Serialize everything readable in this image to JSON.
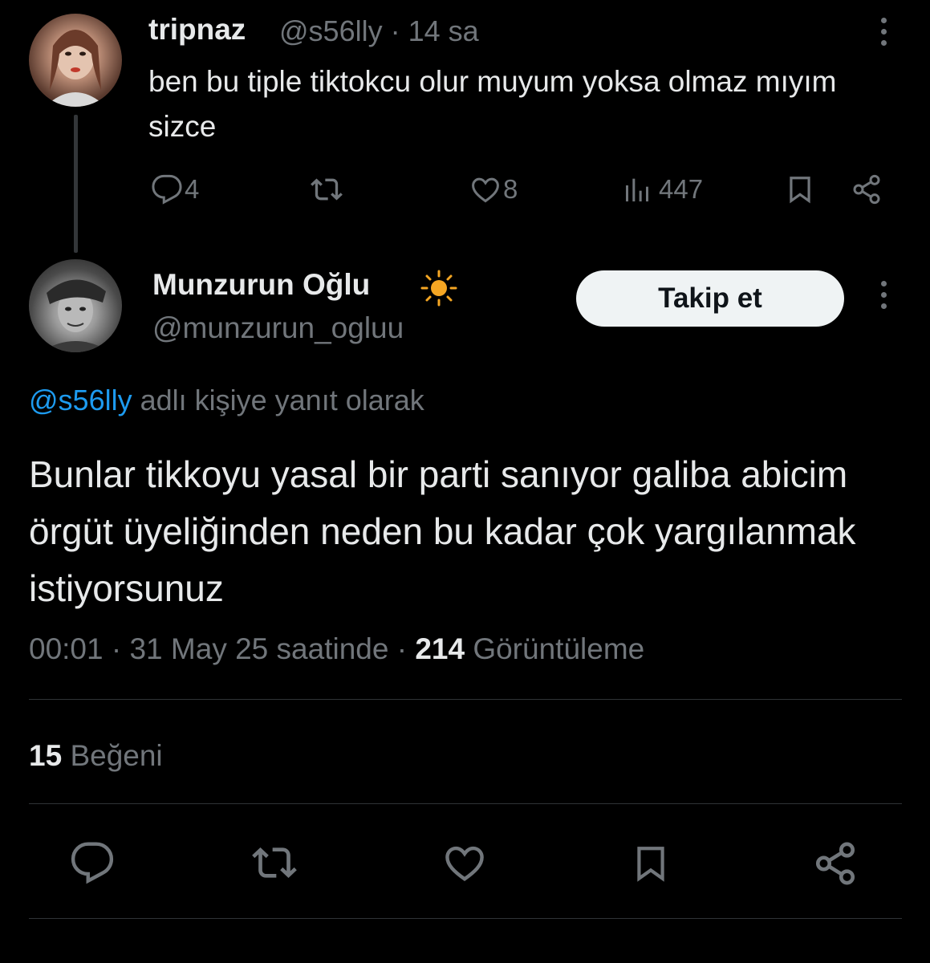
{
  "parent_tweet": {
    "name": "tripnaz",
    "handle": "@s56lly",
    "time": "14 sa",
    "separator": "·",
    "text": "ben bu tiple tiktokcu olur muyum yoksa olmaz mıyım sizce",
    "replies": "4",
    "likes": "8",
    "views": "447"
  },
  "main_tweet": {
    "name": "Munzurun Oğlu",
    "handle": "@munzurun_ogluu",
    "follow_label": "Takip et",
    "reply_mention": "@s56lly",
    "reply_suffix": " adlı kişiye yanıt olarak",
    "text": "Bunlar tikkoyu yasal bir parti sanıyor galiba abicim örgüt üyeliğinden neden bu kadar çok yargılanmak istiyorsunuz",
    "time": "00:01",
    "date": "31 May 25 saatinde",
    "views_count": "214",
    "views_label": "Görüntüleme",
    "likes_count": "15",
    "likes_label": "Beğeni"
  },
  "colors": {
    "background": "#000000",
    "text": "#e7e9ea",
    "muted": "#71767b",
    "link": "#1d9bf0",
    "divider": "#2f3336",
    "follow_button_bg": "#eff3f4",
    "sun_badge": "#f5a623"
  },
  "icons": {
    "reply": "speech-bubble-icon",
    "retweet": "retweet-arrows-icon",
    "like": "heart-icon",
    "views": "bar-chart-icon",
    "bookmark": "bookmark-icon",
    "share": "share-nodes-icon",
    "more": "vertical-dots-icon",
    "badge": "sun-icon"
  }
}
